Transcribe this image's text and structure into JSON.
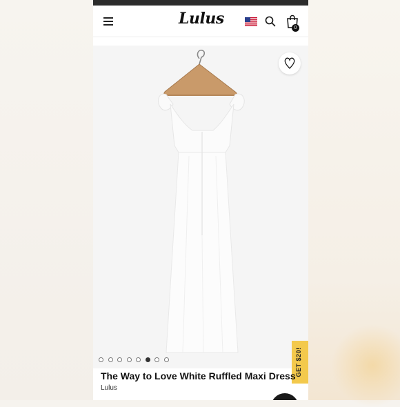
{
  "header": {
    "logo_text": "Lulus",
    "bag_count": "0",
    "flag": "us-flag-icon"
  },
  "product": {
    "title": "The Way to Love White Ruffled Maxi Dress",
    "brand": "Lulus",
    "image_count": 8,
    "active_image_index": 5
  },
  "promo": {
    "label": "GET $20!"
  },
  "colors": {
    "accent_promo": "#f3c94c",
    "topbar": "#2c2c2c",
    "text": "#111111"
  }
}
